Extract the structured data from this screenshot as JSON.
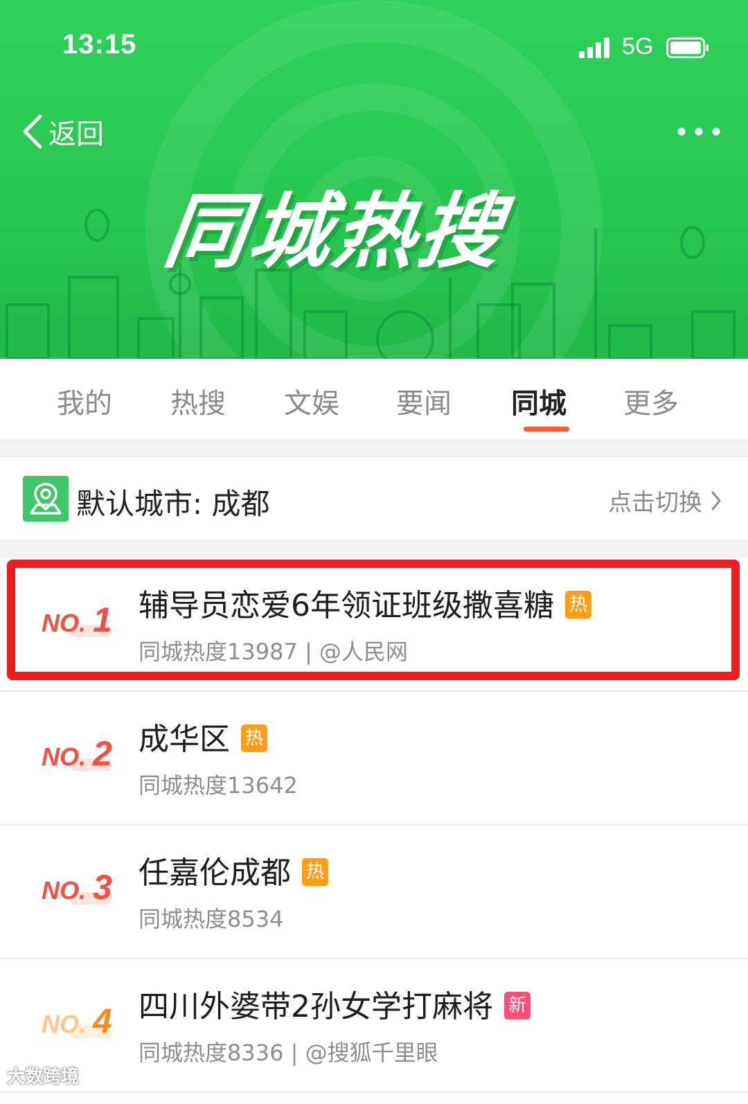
{
  "status_bar": {
    "time": "13:15",
    "network": "5G"
  },
  "header": {
    "back_label": "返回",
    "hero_title": "同城热搜"
  },
  "tabs": [
    {
      "label": "我的"
    },
    {
      "label": "热搜"
    },
    {
      "label": "文娱"
    },
    {
      "label": "要闻"
    },
    {
      "label": "同城",
      "active": true
    },
    {
      "label": "更多"
    }
  ],
  "city": {
    "label": "默认城市: 成都",
    "switch_label": "点击切换"
  },
  "list": [
    {
      "rank_prefix": "NO.",
      "rank": "1",
      "title": "辅导员恋爱6年领证班级撒喜糖",
      "badge": "热",
      "badge_type": "hot",
      "meta": "同城热度13987 | @人民网",
      "highlighted": true
    },
    {
      "rank_prefix": "NO.",
      "rank": "2",
      "title": "成华区",
      "badge": "热",
      "badge_type": "hot",
      "meta": "同城热度13642"
    },
    {
      "rank_prefix": "NO.",
      "rank": "3",
      "title": "任嘉伦成都",
      "badge": "热",
      "badge_type": "hot",
      "meta": "同城热度8534"
    },
    {
      "rank_prefix": "NO.",
      "rank": "4",
      "title": "四川外婆带2孙女学打麻将",
      "badge": "新",
      "badge_type": "new",
      "meta": "同城热度8336 | @搜狐千里眼"
    }
  ],
  "watermark": "大数跨境",
  "colors": {
    "header_green": "#27c64f",
    "accent_red": "#ff5a36",
    "rank_red": "#f44f3f",
    "hot_orange": "#ff9e16",
    "new_pink": "#ff4d7a",
    "highlight_red": "#ee1c1c"
  }
}
